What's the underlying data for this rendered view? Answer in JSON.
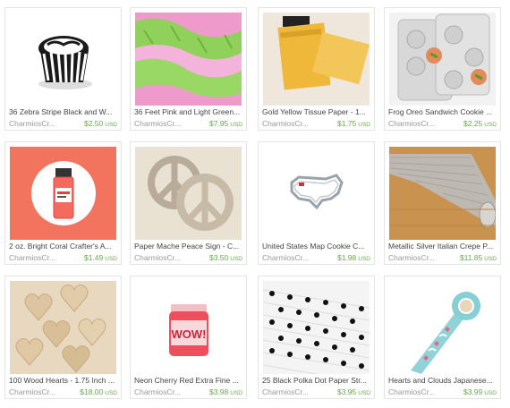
{
  "listings": [
    {
      "title": "36 Zebra Stripe Black and W...",
      "shop": "CharmiosCr...",
      "price": "$2.50",
      "currency": "USD"
    },
    {
      "title": "36 Feet Pink and Light Green...",
      "shop": "CharmiosCr...",
      "price": "$7.95",
      "currency": "USD"
    },
    {
      "title": "Gold Yellow Tissue Paper - 1...",
      "shop": "CharmiosCr...",
      "price": "$1.75",
      "currency": "USD"
    },
    {
      "title": "Frog Oreo Sandwich Cookie ...",
      "shop": "CharmiosCr...",
      "price": "$2.25",
      "currency": "USD"
    },
    {
      "title": "2 oz. Bright Coral Crafter's A...",
      "shop": "CharmiosCr...",
      "price": "$1.49",
      "currency": "USD"
    },
    {
      "title": "Paper Mache Peace Sign - C...",
      "shop": "CharmiosCr...",
      "price": "$3.50",
      "currency": "USD"
    },
    {
      "title": "United States Map Cookie C...",
      "shop": "CharmiosCr...",
      "price": "$1.98",
      "currency": "USD"
    },
    {
      "title": "Metallic Silver Italian Crepe P...",
      "shop": "CharmiosCr...",
      "price": "$11.85",
      "currency": "USD"
    },
    {
      "title": "100 Wood Hearts - 1.75 Inch ...",
      "shop": "CharmiosCr...",
      "price": "$18.00",
      "currency": "USD"
    },
    {
      "title": "Neon Cherry Red Extra Fine ...",
      "shop": "CharmiosCr...",
      "price": "$3.98",
      "currency": "USD"
    },
    {
      "title": "25 Black Polka Dot Paper Str...",
      "shop": "CharmiosCr...",
      "price": "$3.95",
      "currency": "USD"
    },
    {
      "title": "Hearts and Clouds Japanese...",
      "shop": "CharmiosCr...",
      "price": "$3.99",
      "currency": "USD"
    }
  ],
  "product_labels": {
    "wow_jar_label": "WOW!"
  },
  "colors": {
    "price_green": "#6aa84f",
    "coral_background": "#f2735e"
  }
}
